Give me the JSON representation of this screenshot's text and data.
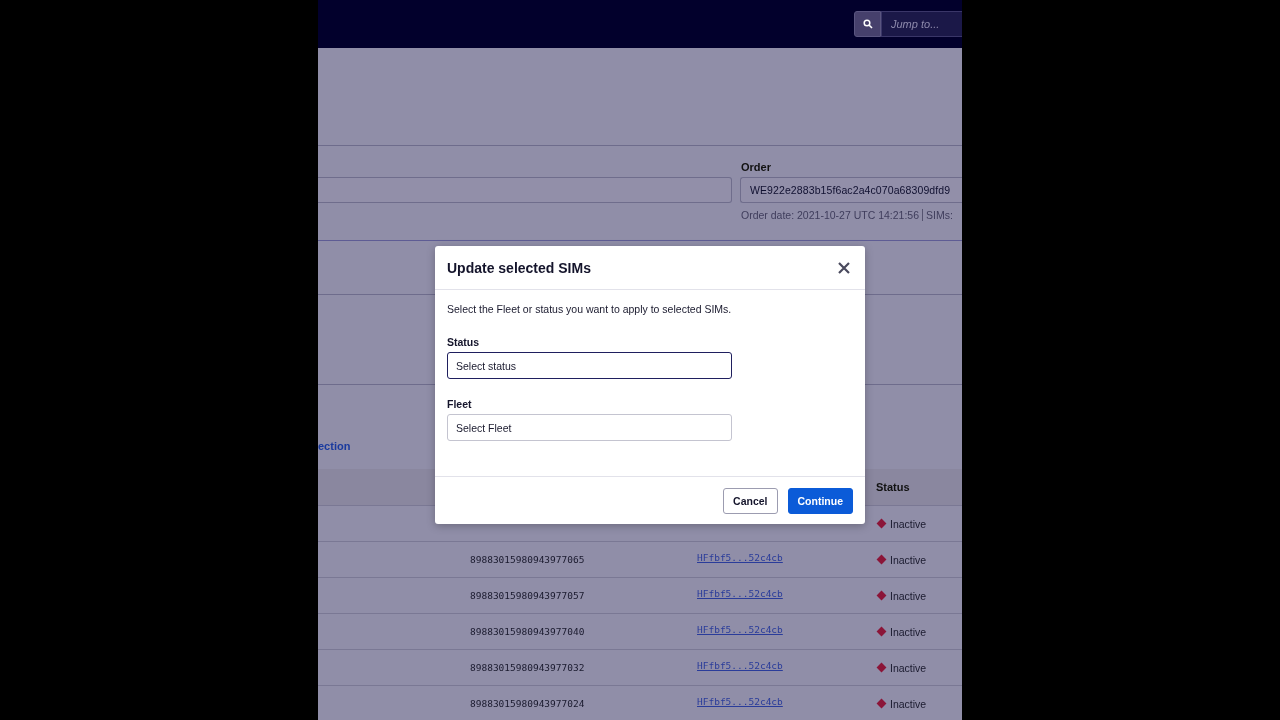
{
  "top_bar": {
    "search": {
      "placeholder": "Jump to..."
    }
  },
  "order_section": {
    "order_label": "Order",
    "order_value": "WE922e2883b15f6ac2a4c070a68309dfd9",
    "order_date": "Order date: 2021-10-27 UTC 14:21:56",
    "sims_label": "SIMs:"
  },
  "link_fragment": "ection",
  "table": {
    "columns": [
      {
        "label": "Status"
      }
    ],
    "rows": [
      {
        "status": "Inactive",
        "color": "#8b1538"
      },
      {
        "iccid": "89883015980943977065",
        "link": "HFfbf5...52c4cb",
        "status": "Inactive",
        "color": "#8b1538"
      },
      {
        "iccid": "89883015980943977057",
        "link": "HFfbf5...52c4cb",
        "status": "Inactive",
        "color": "#8b1538"
      },
      {
        "iccid": "89883015980943977040",
        "link": "HFfbf5...52c4cb",
        "status": "Inactive",
        "color": "#8b1538"
      },
      {
        "iccid": "89883015980943977032",
        "link": "HFfbf5...52c4cb",
        "status": "Inactive",
        "color": "#8b1538"
      },
      {
        "iccid": "89883015980943977024",
        "link": "HFfbf5...52c4cb",
        "status": "Inactive",
        "color": "#8b1538"
      }
    ]
  },
  "dialog": {
    "title": "Update selected SIMs",
    "description": "Select the Fleet or status you want to apply to selected SIMs.",
    "fields": [
      {
        "label": "Status",
        "placeholder": "Select status",
        "focused": true
      },
      {
        "label": "Fleet",
        "placeholder": "Select Fleet",
        "focused": false
      }
    ],
    "buttons": [
      {
        "label": "Cancel",
        "kind": "secondary"
      },
      {
        "label": "Continue",
        "kind": "primary"
      }
    ]
  }
}
